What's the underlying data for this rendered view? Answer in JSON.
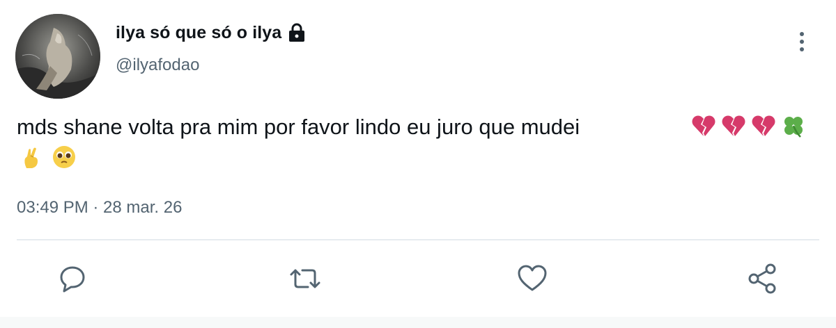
{
  "tweet": {
    "display_name": "ilya só que só o ilya",
    "handle": "@ilyafodao",
    "text": "mds shane volta pra mim por favor lindo eu juro que mudei",
    "emojis_line1": [
      "broken-heart",
      "broken-heart",
      "broken-heart",
      "four-leaf-clover"
    ],
    "emojis_line2": [
      "crossed-fingers",
      "pleading-face"
    ],
    "timestamp": "03:49 PM · 28 mar. 26",
    "protected_icon": "lock-icon"
  },
  "actions": {
    "reply_icon": "reply-icon",
    "retweet_icon": "retweet-icon",
    "like_icon": "heart-icon",
    "share_icon": "share-icon"
  },
  "colors": {
    "text_primary": "#0f1419",
    "text_secondary": "#536471",
    "divider": "#e6ecf0",
    "broken_heart": "#d63a6a",
    "clover": "#5cae4a"
  }
}
